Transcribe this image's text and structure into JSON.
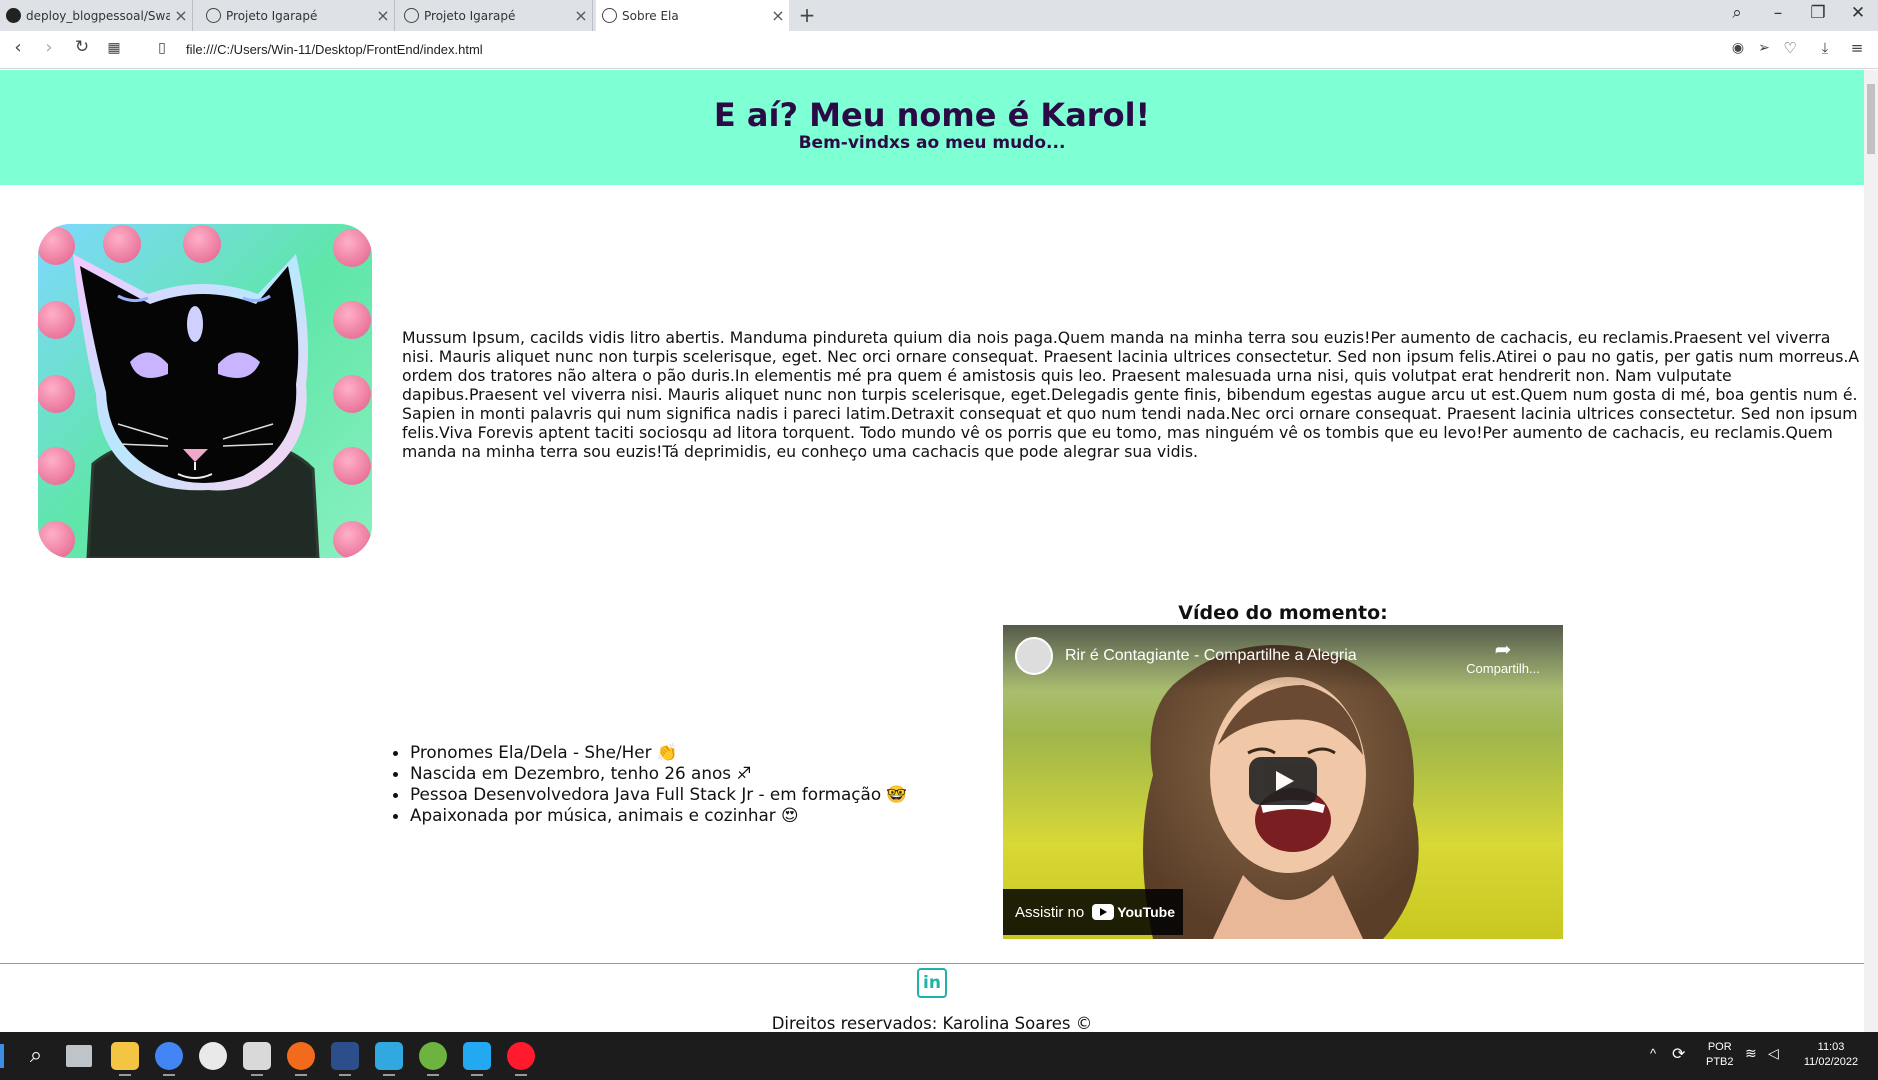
{
  "browser": {
    "tabs": [
      {
        "title": "deploy_blogpessoal/Swagg",
        "favicon": "github-icon"
      },
      {
        "title": "Projeto Igarapé",
        "favicon": "globe-icon"
      },
      {
        "title": "Projeto Igarapé",
        "favicon": "globe-icon"
      },
      {
        "title": "Sobre Ela",
        "favicon": "globe-icon",
        "active": true
      }
    ],
    "new_tab": "+",
    "url": "file:///C:/Users/Win-11/Desktop/FrontEnd/index.html"
  },
  "page": {
    "header": {
      "title": "E aí? Meu nome é Karol!",
      "subtitle": "Bem-vindxs ao meu mudo..."
    },
    "intro_text": "Mussum Ipsum, cacilds vidis litro abertis. Manduma pindureta quium dia nois paga.Quem manda na minha terra sou euzis!Per aumento de cachacis, eu reclamis.Praesent vel viverra nisi. Mauris aliquet nunc non turpis scelerisque, eget. Nec orci ornare consequat. Praesent lacinia ultrices consectetur. Sed non ipsum felis.Atirei o pau no gatis, per gatis num morreus.A ordem dos tratores não altera o pão duris.In elementis mé pra quem é amistosis quis leo. Praesent malesuada urna nisi, quis volutpat erat hendrerit non. Nam vulputate dapibus.Praesent vel viverra nisi. Mauris aliquet nunc non turpis scelerisque, eget.Delegadis gente finis, bibendum egestas augue arcu ut est.Quem num gosta di mé, boa gentis num é. Sapien in monti palavris qui num significa nadis i pareci latim.Detraxit consequat et quo num tendi nada.Nec orci ornare consequat. Praesent lacinia ultrices consectetur. Sed non ipsum felis.Viva Forevis aptent taciti sociosqu ad litora torquent. Todo mundo vê os porris que eu tomo, mas ninguém vê os tombis que eu levo!Per aumento de cachacis, eu reclamis.Quem manda na minha terra sou euzis!Tá deprimidis, eu conheço uma cachacis que pode alegrar sua vidis.",
    "facts": [
      "Pronomes Ela/Dela - She/Her 👏",
      "Nascida em Dezembro, tenho 26 anos ♐",
      "Pessoa Desenvolvedora Java Full Stack Jr - em formação 🤓",
      "Apaixonada por música, animais e cozinhar 😍"
    ],
    "video": {
      "section_title": "Vídeo do momento:",
      "title": "Rir é Contagiante - Compartilhe a Alegria",
      "share_label": "Compartilh...",
      "watch_on": "Assistir no",
      "youtube": "YouTube"
    },
    "footer": {
      "linkedin": "in",
      "copyright": "Direitos reservados: Karolina Soares ©"
    }
  },
  "taskbar": {
    "lang_top": "POR",
    "lang_bottom": "PTB2",
    "time": "11:03",
    "date": "11/02/2022"
  },
  "colors": {
    "hero_bg": "#7fffd4",
    "hero_text": "#2b0b45",
    "linkedin": "#20b2aa"
  }
}
